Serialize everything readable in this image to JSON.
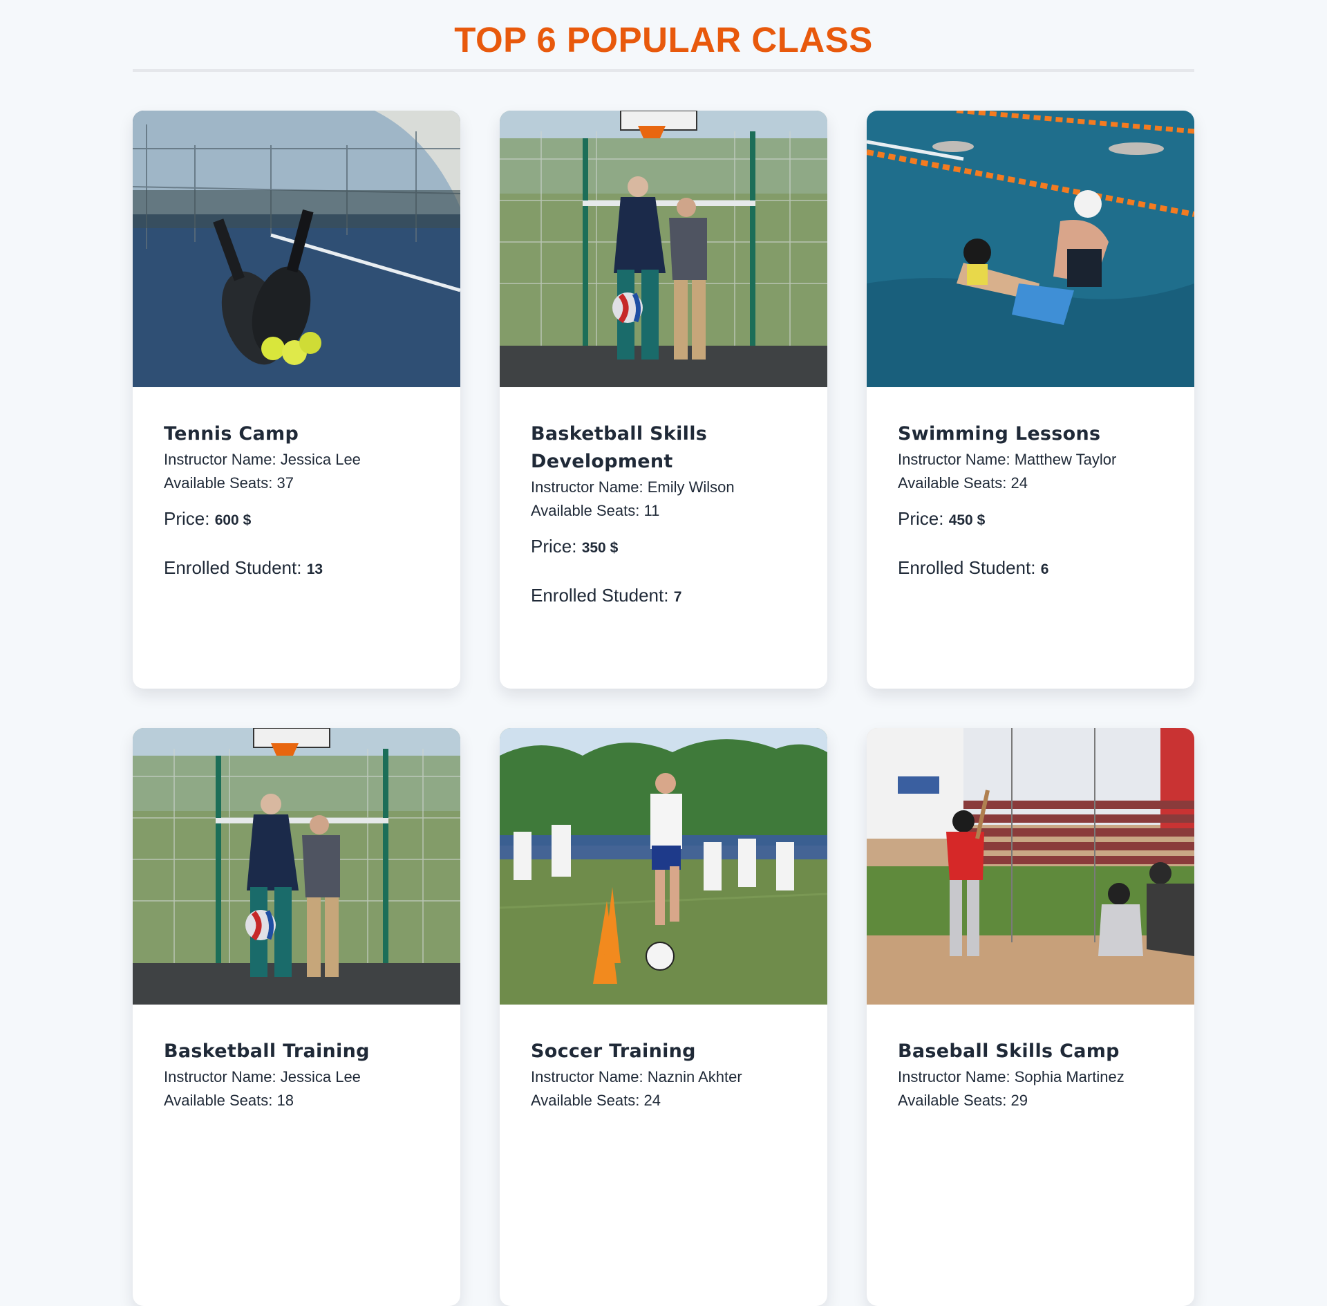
{
  "page": {
    "title": "TOP 6 POPULAR CLASS"
  },
  "labels": {
    "instructor": "Instructor Name:",
    "seats": "Available Seats:",
    "price": "Price:",
    "enrolled": "Enrolled Student:"
  },
  "classes": [
    {
      "title": "Tennis Camp",
      "instructor": "Jessica Lee",
      "seats": "37",
      "price": "600 $",
      "enrolled": "13",
      "image": "tennis-court-photo"
    },
    {
      "title": "Basketball Skills Development",
      "instructor": "Emily Wilson",
      "seats": "11",
      "price": "350 $",
      "enrolled": "7",
      "image": "basketball-practice-photo"
    },
    {
      "title": "Swimming Lessons",
      "instructor": "Matthew Taylor",
      "seats": "24",
      "price": "450 $",
      "enrolled": "6",
      "image": "swimming-pool-photo"
    },
    {
      "title": "Basketball Training",
      "instructor": "Jessica Lee",
      "seats": "18",
      "price": "",
      "enrolled": "",
      "image": "basketball-practice-photo"
    },
    {
      "title": "Soccer Training",
      "instructor": "Naznin Akhter",
      "seats": "24",
      "price": "",
      "enrolled": "",
      "image": "soccer-field-photo"
    },
    {
      "title": "Baseball Skills Camp",
      "instructor": "Sophia Martinez",
      "seats": "29",
      "price": "",
      "enrolled": "",
      "image": "baseball-field-photo"
    }
  ]
}
